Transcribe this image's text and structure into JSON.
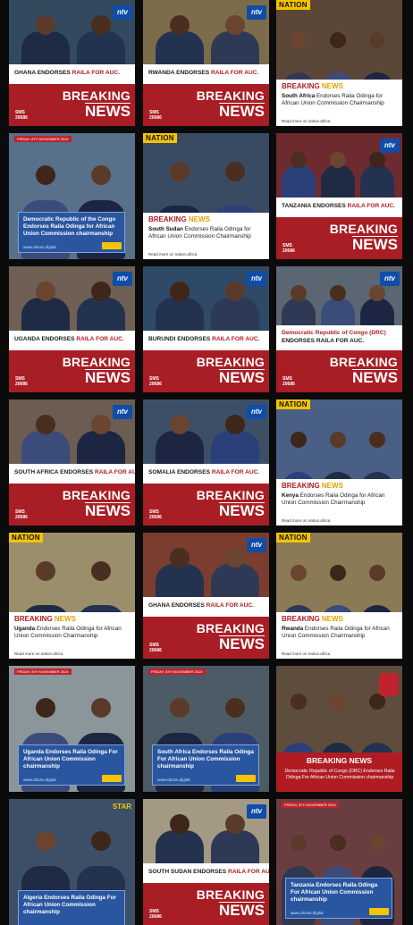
{
  "brand": {
    "breaking_l1": "BREAKING",
    "breaking_l2": "NEWS",
    "sms_label": "SMS",
    "sms_code": "20686",
    "ntv": "ntv",
    "nation": "NATION",
    "star": "STAR",
    "read_more": "Read more on nation.africa",
    "web": "www.citizen.digital",
    "date_tag": "FRIDAY, 8TH NOVEMBER 2024"
  },
  "colors": {
    "red": "#a91d24",
    "blue": "#2a56a0",
    "gold": "#f5c400"
  },
  "tiles": [
    {
      "kind": "ntv",
      "pre": "GHANA ENDORSES ",
      "hl": "RAILA FOR AUC."
    },
    {
      "kind": "ntv",
      "pre": "RWANDA ENDORSES ",
      "hl": "RAILA FOR AUC."
    },
    {
      "kind": "nation",
      "country": "South Africa",
      "rest": " Endorses Raila Odinga for African Union Commission Chairmanship"
    },
    {
      "kind": "citizen",
      "text": "Democratic Republic of the Congo Endorses Raila Odinga for African Union Commission chairmanship"
    },
    {
      "kind": "nation",
      "country": "South Sudan",
      "rest": " Endorses Raila Odinga for African Union Commission Chairmanship"
    },
    {
      "kind": "ntv",
      "pre": "TANZANIA ENDORSES ",
      "hl": "RAILA FOR AUC."
    },
    {
      "kind": "ntv",
      "pre": "UGANDA ENDORSES ",
      "hl": "RAILA FOR AUC."
    },
    {
      "kind": "ntv",
      "pre": "BURUNDI ENDORSES ",
      "hl": "RAILA FOR AUC."
    },
    {
      "kind": "ntv2",
      "pre": "Democratic Republic of Congo (DRC)",
      "hl": "ENDORSES RAILA FOR AUC."
    },
    {
      "kind": "ntv",
      "pre": "SOUTH AFRICA ENDORSES ",
      "hl": "RAILA FOR AUC."
    },
    {
      "kind": "ntv",
      "pre": "SOMALIA ENDORSES ",
      "hl": "RAILA FOR AUC."
    },
    {
      "kind": "nation",
      "country": "Kenya",
      "rest": " Endorses Raila Odinga for African Union Commission Chairmanship"
    },
    {
      "kind": "nation",
      "country": "Uganda",
      "rest": " Endorses Raila Odinga for African Union Commission Chairmanship"
    },
    {
      "kind": "ntv",
      "pre": "GHANA ENDORSES ",
      "hl": "RAILA FOR AUC."
    },
    {
      "kind": "nation",
      "country": "Rwanda",
      "rest": " Endorses Raila Odinga for African Union Commission Chairmanship"
    },
    {
      "kind": "citizen",
      "text": "Uganda Endorses Raila Odinga For African Union Commission chairmanship"
    },
    {
      "kind": "citizen",
      "text": "South Africa Endorses Raila Odinga For African Union Commission chairmanship"
    },
    {
      "kind": "tv",
      "title": "BREAKING NEWS",
      "text": "Democratic Republic of Congo (DRC) Endorses Raila Odinga For African Union Commission chairmanship"
    },
    {
      "kind": "star",
      "text": "Algeria Endorses Raila Odinga For African Union Commission chairmanship"
    },
    {
      "kind": "ntv",
      "pre": "SOUTH SUDAN ENDORSES ",
      "hl": "RAILA FOR AUC."
    },
    {
      "kind": "citizen",
      "text": "Tanzania Endorses Raila Odinga For African Union Commission chairmanship"
    }
  ]
}
